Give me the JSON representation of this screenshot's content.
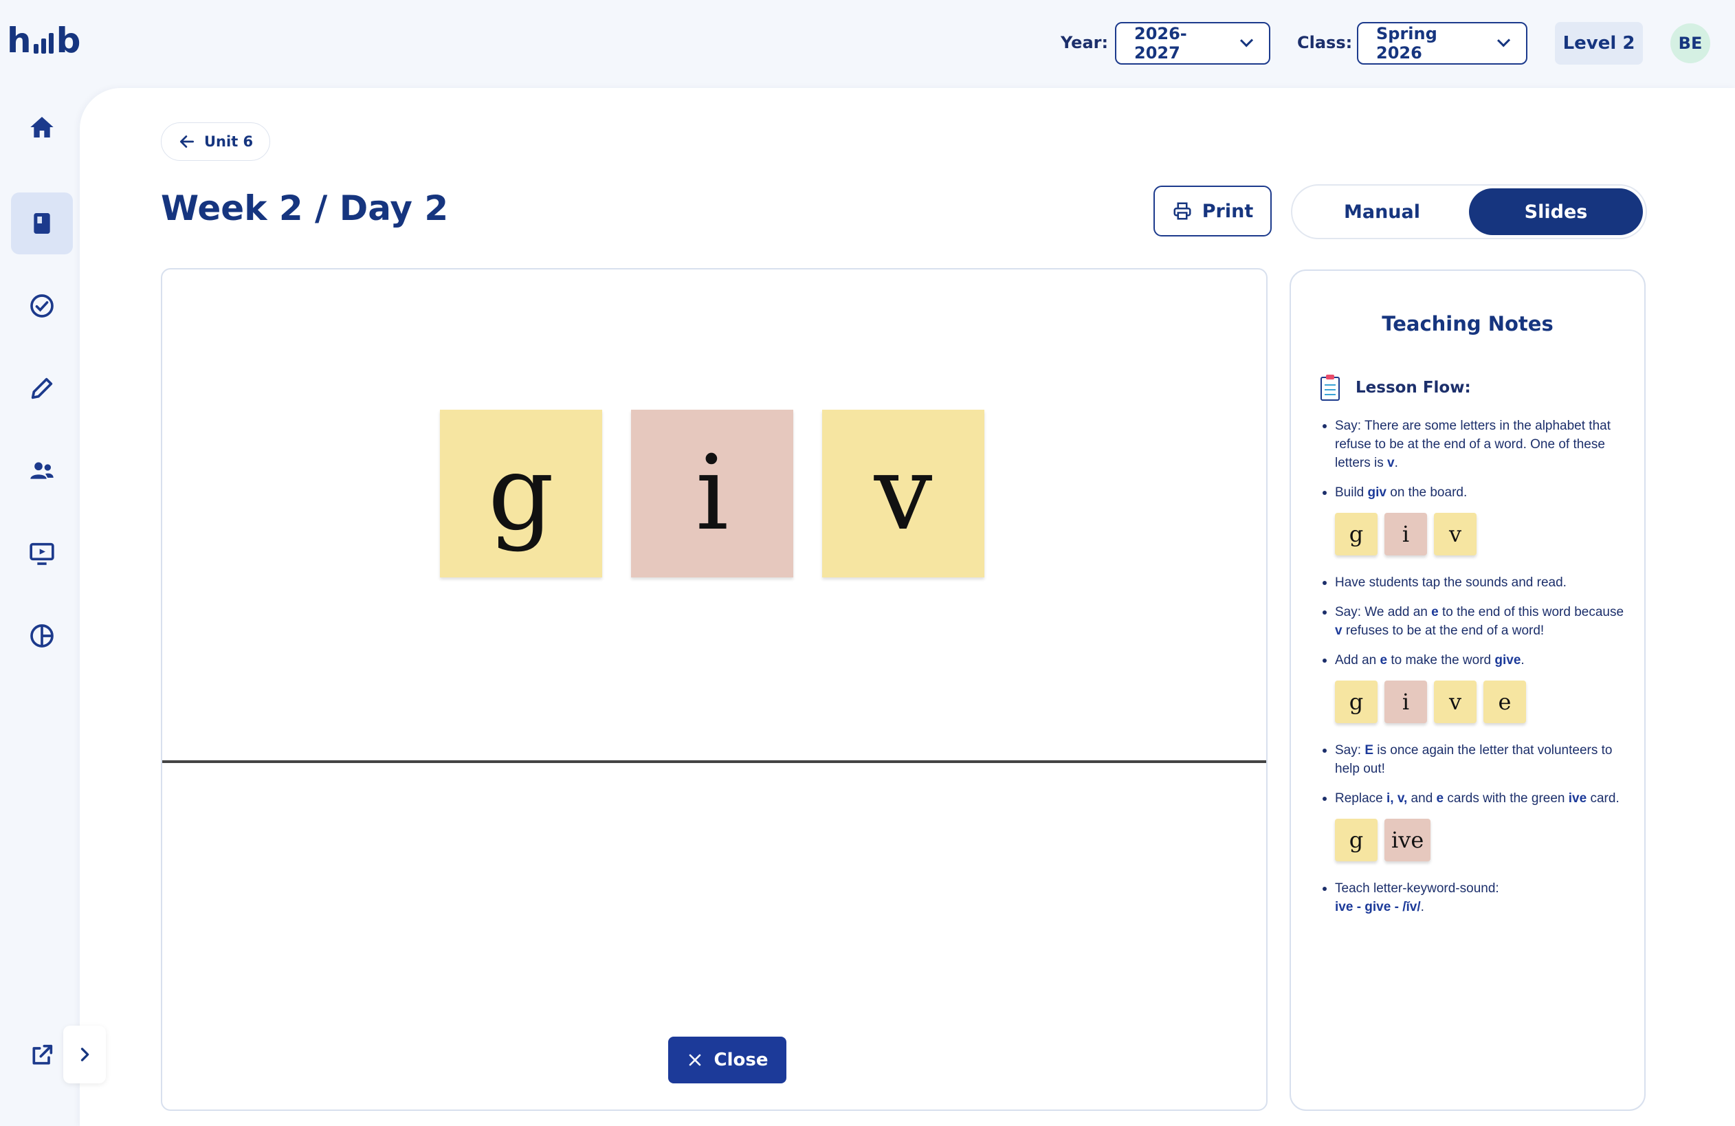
{
  "header": {
    "logo": "hub",
    "year_label": "Year:",
    "year_value": "2026-2027",
    "class_label": "Class:",
    "class_value": "Spring 2026",
    "level": "Level 2",
    "avatar_initials": "BE"
  },
  "sidebar": {
    "items": [
      {
        "name": "home",
        "icon": "home-icon"
      },
      {
        "name": "lessons",
        "icon": "book-icon",
        "active": true
      },
      {
        "name": "assessments",
        "icon": "check-circle-icon"
      },
      {
        "name": "edit",
        "icon": "pencil-icon"
      },
      {
        "name": "students",
        "icon": "people-icon"
      },
      {
        "name": "presentation",
        "icon": "monitor-play-icon"
      },
      {
        "name": "reports",
        "icon": "pie-chart-icon"
      }
    ],
    "bottom_icon": "external-link-icon",
    "expand_icon": "chevron-right-icon"
  },
  "page": {
    "back_label": "Unit 6",
    "title": "Week 2 / Day 2",
    "print_label": "Print",
    "toggle_manual": "Manual",
    "toggle_slides": "Slides",
    "active_view": "Slides"
  },
  "slide": {
    "tiles": [
      {
        "letter": "g",
        "color": "yellow"
      },
      {
        "letter": "i",
        "color": "pink"
      },
      {
        "letter": "v",
        "color": "yellow"
      }
    ],
    "close_label": "Close"
  },
  "notes": {
    "title": "Teaching Notes",
    "flow_heading": "Lesson Flow:",
    "item1_pre": "Say: There are some letters in the alphabet that refuse to be at the end of a word. One of these letters is ",
    "item1_bold": "v",
    "item1_post": ".",
    "item2_pre": "Build ",
    "item2_bold": "giv",
    "item2_post": " on the board.",
    "row1": [
      "g",
      "i",
      "v"
    ],
    "item3": "Have students tap the sounds and read.",
    "item4_pre": "Say: We add an ",
    "item4_b1": "e",
    "item4_mid": " to the end of this word because ",
    "item4_b2": "v",
    "item4_post": " refuses to be at the end of a word!",
    "item5_pre": "Add an ",
    "item5_b1": "e",
    "item5_mid": " to make the word ",
    "item5_b2": "give",
    "item5_post": ".",
    "row2": [
      "g",
      "i",
      "v",
      "e"
    ],
    "item6_pre": "Say: ",
    "item6_bold": "E",
    "item6_post": " is once again the letter that volunteers to help out!",
    "item7_pre": "Replace ",
    "item7_b1": "i, v,",
    "item7_mid1": " and ",
    "item7_b2": "e",
    "item7_mid2": " cards with the green ",
    "item7_b3": "ive",
    "item7_post": " card.",
    "row3": [
      "g",
      "ive"
    ],
    "item8_pre": "Teach letter-keyword-sound:",
    "item8_bold": "ive - give - /ĭv/",
    "item8_post": "."
  },
  "colors": {
    "brand": "#16357f",
    "tile_yellow": "#f6e5a1",
    "tile_pink": "#e6c8be",
    "close_button": "#1c3a99",
    "active_nav": "#dbe4f6"
  }
}
